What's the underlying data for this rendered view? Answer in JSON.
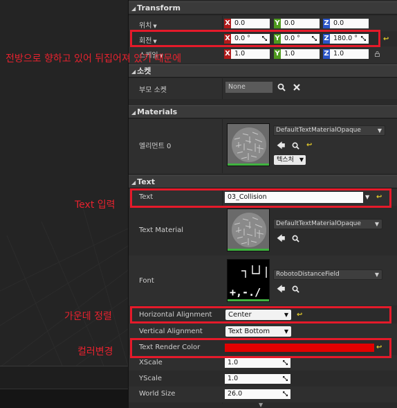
{
  "transform": {
    "title": "Transform",
    "location": {
      "label": "위치",
      "x": "0.0",
      "y": "0.0",
      "z": "0.0"
    },
    "rotation": {
      "label": "회전",
      "x": "0.0 °",
      "y": "0.0 °",
      "z": "180.0 °"
    },
    "scale": {
      "label": "스케일",
      "x": "1.0",
      "y": "1.0",
      "z": "1.0"
    },
    "axis_labels": {
      "x": "X",
      "y": "Y",
      "z": "Z"
    }
  },
  "socket": {
    "title": "소켓",
    "parent_socket_label": "부모 소켓",
    "parent_socket_value": "None"
  },
  "materials": {
    "title": "Materials",
    "element_label": "엘리먼트 0",
    "material_name": "DefaultTextMaterialOpaque",
    "texture_button": "텍스처"
  },
  "text_section": {
    "title": "Text",
    "text_label": "Text",
    "text_value": "03_Collision",
    "text_material_label": "Text Material",
    "text_material_value": "DefaultTextMaterialOpaque",
    "font_label": "Font",
    "font_value": "RobotoDistanceField",
    "h_align_label": "Horizontal Alignment",
    "h_align_value": "Center",
    "v_align_label": "Vertical Alignment",
    "v_align_value": "Text Bottom",
    "color_label": "Text Render Color",
    "color_value": "#e20000",
    "xscale_label": "XScale",
    "xscale_value": "1.0",
    "yscale_label": "YScale",
    "yscale_value": "1.0",
    "world_size_label": "World Size",
    "world_size_value": "26.0"
  },
  "annotations": {
    "rotation_note": "전방으로 향하고 있어 뒤집어져 있기 때문에",
    "text_note": "Text 입력",
    "center_note": "가운데 정렬",
    "color_note": "컬러변경"
  },
  "colors": {
    "annotation_red": "#e8222e",
    "axis_x": "#b21a1a",
    "axis_y": "#4f9b1e",
    "axis_z": "#2a55c8",
    "reset_yellow": "#e0c82a"
  },
  "font_preview_text": "+,-./"
}
